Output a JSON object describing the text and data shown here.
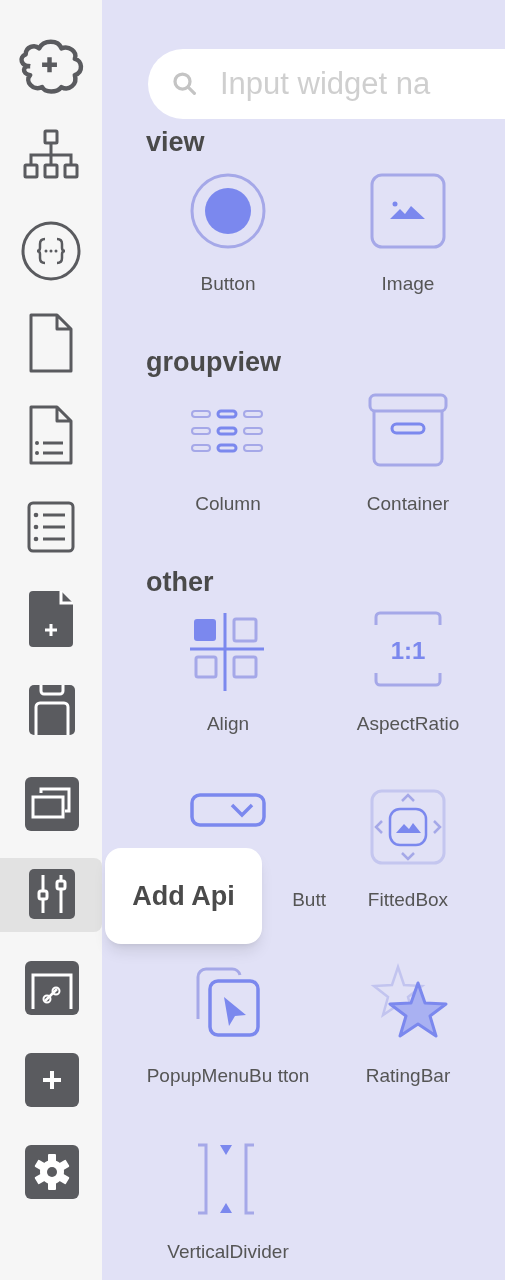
{
  "sidebar": {
    "items": [
      {
        "selected": false
      },
      {
        "selected": false
      },
      {
        "selected": false
      },
      {
        "selected": false
      },
      {
        "selected": false
      },
      {
        "selected": false
      },
      {
        "selected": false
      },
      {
        "selected": false
      },
      {
        "selected": false
      },
      {
        "selected": true
      },
      {
        "selected": false
      },
      {
        "selected": false
      },
      {
        "selected": false
      }
    ]
  },
  "tooltip": {
    "text": "Add Api"
  },
  "search": {
    "placeholder": "Input widget na"
  },
  "sections": [
    {
      "title": "view",
      "widgets": [
        {
          "label": "Button"
        },
        {
          "label": "Image"
        }
      ]
    },
    {
      "title": "groupview",
      "widgets": [
        {
          "label": "Column"
        },
        {
          "label": "Container"
        }
      ]
    },
    {
      "title": "other",
      "widgets": [
        {
          "label": "Align"
        },
        {
          "label": "AspectRatio",
          "icon_text": "1:1"
        },
        {
          "label": "Butt",
          "covered": true
        },
        {
          "label": "FittedBox"
        },
        {
          "label": "PopupMenuBu tton"
        },
        {
          "label": "RatingBar"
        },
        {
          "label": "VerticalDivider"
        }
      ]
    }
  ]
}
